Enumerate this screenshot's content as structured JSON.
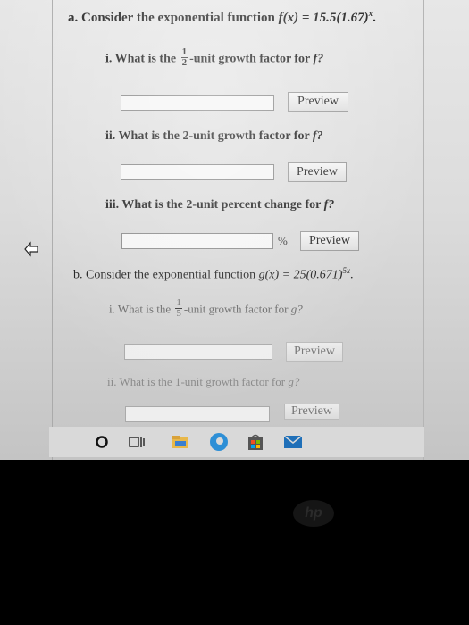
{
  "part_a": {
    "label": "a.",
    "intro_text": "Consider the exponential function",
    "fn_lhs": "f(x) = 15.5(1.67)",
    "fn_exp": "x",
    "q1": {
      "label": "i.",
      "before": "What is the",
      "frac_num": "1",
      "frac_den": "2",
      "after": "-unit growth factor for",
      "var": "f?"
    },
    "q2": {
      "label": "ii.",
      "text": "What is the 2-unit growth factor for",
      "var": "f?"
    },
    "q3": {
      "label": "iii.",
      "text": "What is the 2-unit percent change for",
      "var": "f?"
    },
    "percent_sign": "%"
  },
  "part_b": {
    "label": "b.",
    "intro_text": "Consider the exponential function",
    "fn_lhs": "g(x) = 25(0.671)",
    "fn_exp": "5x",
    "q1": {
      "label": "i.",
      "before": "What is the",
      "frac_num": "1",
      "frac_den": "5",
      "after": "-unit growth factor for",
      "var": "g?"
    },
    "q2": {
      "label": "ii.",
      "text": "What is the 1-unit growth factor for",
      "var": "g?"
    }
  },
  "preview_label": "Preview",
  "answers": {
    "a1": "",
    "a2": "",
    "a3": "",
    "b1": "",
    "b2": ""
  },
  "taskbar": {
    "icons": [
      "cortana-icon",
      "task-view-icon",
      "file-explorer-icon",
      "edge-icon",
      "store-icon",
      "mail-icon"
    ]
  },
  "brand_logo": "hp"
}
